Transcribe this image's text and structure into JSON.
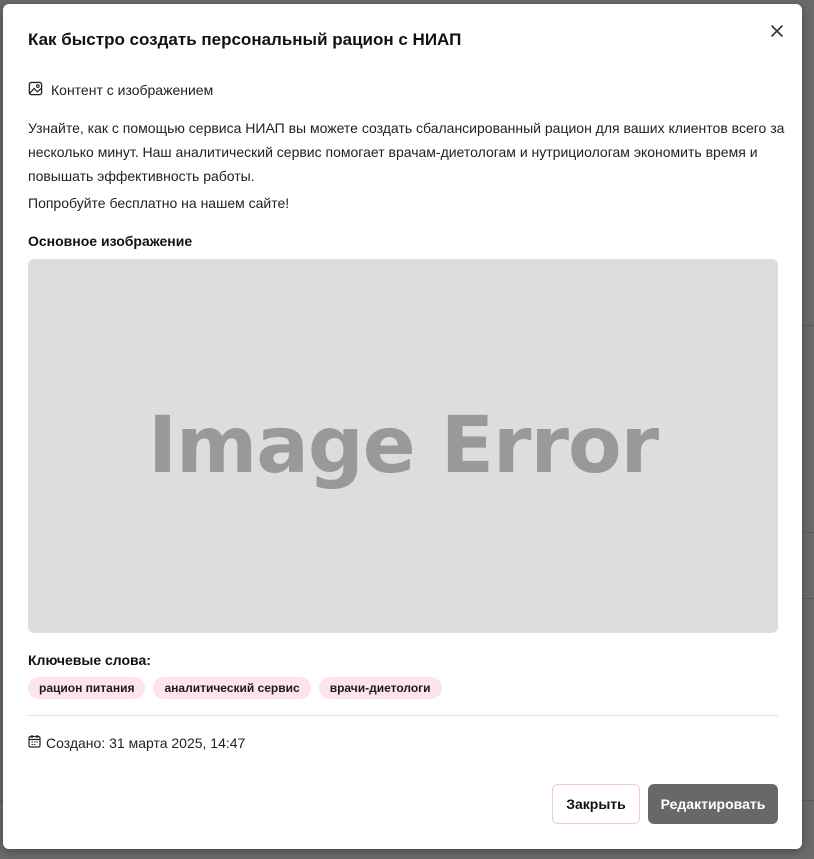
{
  "dialog": {
    "title": "Как быстро создать персональный рацион с НИАП",
    "close_icon": "close-icon",
    "content_type": {
      "icon": "image-icon",
      "label": "Контент с изображением"
    },
    "description": [
      "Узнайте, как с помощью сервиса НИАП вы можете создать сбалансированный рацион для ваших клиентов всего за несколько минут. Наш аналитический сервис помогает врачам-диетологам и нутрициологам экономить время и повышать эффективность работы.",
      "Попробуйте бесплатно на нашем сайте!"
    ],
    "main_image": {
      "label": "Основное изображение",
      "placeholder_text": "Image Error"
    },
    "keywords": {
      "label": "Ключевые слова:",
      "items": [
        "рацион питания",
        "аналитический сервис",
        "врачи-диетологи"
      ]
    },
    "created": {
      "icon": "calendar-icon",
      "text": "Создано: 31 марта 2025, 14:47"
    },
    "buttons": {
      "close_label": "Закрыть",
      "edit_label": "Редактировать"
    }
  },
  "colors": {
    "tag_background": "#fde4ea",
    "edit_button": "#686868",
    "image_placeholder_bg": "#dddddd"
  }
}
